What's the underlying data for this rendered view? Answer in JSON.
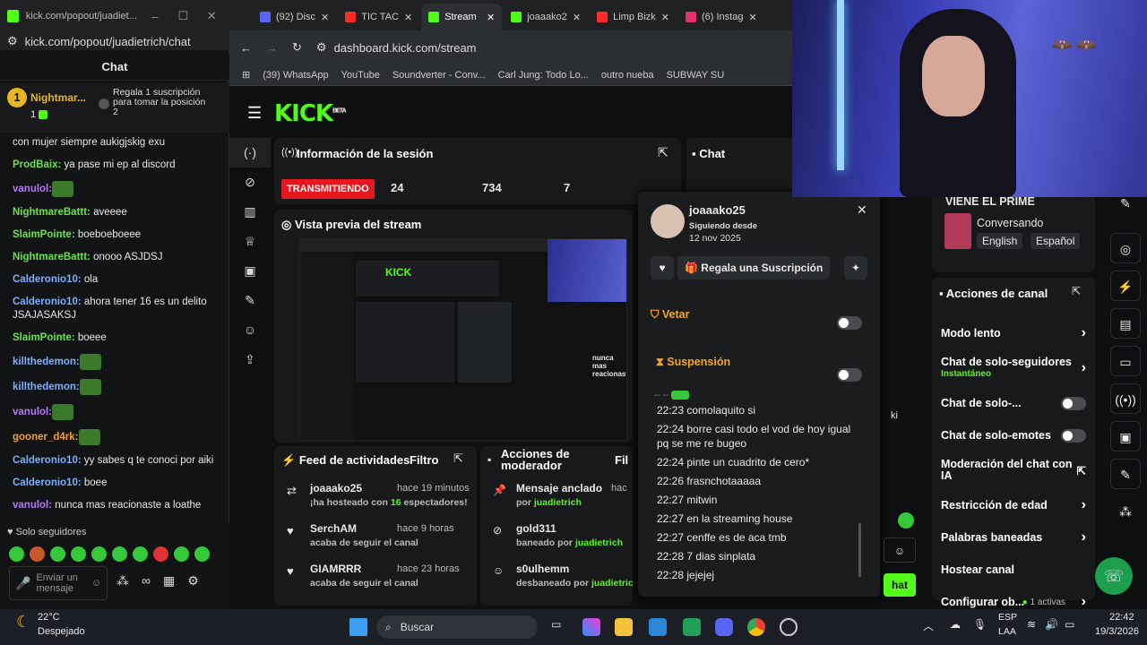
{
  "popout": {
    "title": "kick.com/popout/juadiet...",
    "url": "kick.com/popout/juadietrich/chat",
    "chat_heading": "Chat",
    "pinned_user": "Nightmar...",
    "pinned_rank": "1",
    "pinned_count": "1",
    "pinned_text": "Regala 1 suscripción para tomar la posición 2",
    "messages": [
      {
        "user": "",
        "text": "con mujer siempre aukigjskig exu"
      },
      {
        "user": "ProdBaix:",
        "text": " ya pase mi ep al discord",
        "color": "#6ae24a"
      },
      {
        "user": "vanulol:",
        "text": "",
        "color": "#b877f5"
      },
      {
        "user": "NightmareBattt:",
        "text": " aveeee",
        "color": "#6ae24a"
      },
      {
        "user": "SlaimPointe:",
        "text": " boeboeboeee",
        "color": "#6ae24a"
      },
      {
        "user": "NightmareBattt:",
        "text": " onooo ASJDSJ",
        "color": "#6ae24a"
      },
      {
        "user": "Calderonio10:",
        "text": " ola",
        "color": "#7ab0ff"
      },
      {
        "user": "Calderonio10:",
        "text": " ahora tener 16 es un delito JSAJASAKSJ",
        "color": "#7ab0ff"
      },
      {
        "user": "SlaimPointe:",
        "text": " boeee",
        "color": "#6ae24a"
      },
      {
        "user": "killthedemon:",
        "text": "",
        "color": "#7ab0ff"
      },
      {
        "user": "killthedemon:",
        "text": "",
        "color": "#7ab0ff"
      },
      {
        "user": "vanulol:",
        "text": "",
        "color": "#b877f5"
      },
      {
        "user": "gooner_d4rk:",
        "text": "",
        "color": "#f0a030"
      },
      {
        "user": "Calderonio10:",
        "text": " yy sabes q te conoci por aiki",
        "color": "#7ab0ff"
      },
      {
        "user": "Calderonio10:",
        "text": " boee",
        "color": "#7ab0ff"
      },
      {
        "user": "vanulol:",
        "text": " nunca mas reacionaste a loathe",
        "color": "#b877f5"
      }
    ],
    "followers_only": "Solo seguidores",
    "input_placeholder": "Enviar un mensaje"
  },
  "browser": {
    "tabs": [
      {
        "label": "(92) Disc",
        "color": "#5865f2"
      },
      {
        "label": "TIC TAC",
        "color": "#ff2a2a"
      },
      {
        "label": "Stream",
        "color": "#53fc18",
        "active": true
      },
      {
        "label": "joaaako2",
        "color": "#53fc18"
      },
      {
        "label": "Limp Bizk",
        "color": "#ff2a2a"
      },
      {
        "label": "(6) Instag",
        "color": "#e1306c"
      }
    ],
    "url": "dashboard.kick.com/stream",
    "bookmarks": [
      "(39) WhatsApp",
      "YouTube",
      "Soundverter - Conv...",
      "Carl Jung: Todo Lo...",
      "outro nueba",
      "SUBWAY SU"
    ]
  },
  "kick": {
    "logo": "KICK",
    "beta": "BETA",
    "session_title": "Información de la sesión",
    "live_label": "TRANSMITIENDO",
    "stats": [
      "24",
      "734",
      "7"
    ],
    "preview_title": "Vista previa del stream",
    "chat_title": "Chat",
    "activity_title": "Feed de actividades",
    "filter": "Filtro",
    "activity": [
      {
        "name": "joaaako25",
        "time": "hace 19 minutos",
        "text_a": "¡ha hosteado con ",
        "count": "16",
        "text_b": " espectadores!"
      },
      {
        "name": "SerchAM",
        "time": "hace 9 horas",
        "text_a": "acaba de seguir el canal",
        "count": "",
        "text_b": ""
      },
      {
        "name": "GIAMRRR",
        "time": "hace 23 horas",
        "text_a": "acaba de seguir el canal",
        "count": "",
        "text_b": ""
      }
    ],
    "mod_title": "Acciones de moderador",
    "mod_filter": "Fil",
    "mod_actions": [
      {
        "name": "Mensaje anclado",
        "time": "hac",
        "text": "por ",
        "by": "juadietrich"
      },
      {
        "name": "gold311",
        "time": "",
        "text": "baneado por ",
        "by": "juadietrich"
      },
      {
        "name": "s0ulhemm",
        "time": "",
        "text": "desbaneado por ",
        "by": "juadietric"
      }
    ]
  },
  "popup": {
    "username": "joaaako25",
    "following_label": "Siguiendo desde",
    "following_date": "12 nov 2025",
    "gift_button": "Regala una Suscripción",
    "veto": "Vetar",
    "suspension": "Suspensión",
    "messages": [
      {
        "time": "22:23",
        "text": "comolaquito si"
      },
      {
        "time": "22:24",
        "text": "borre casi todo el vod de hoy igual pq se me re bugeo"
      },
      {
        "time": "22:24",
        "text": "pinte un cuadrito de cero*"
      },
      {
        "time": "22:26",
        "text": "frasnchotaaaaa"
      },
      {
        "time": "22:27",
        "text": "mitwin"
      },
      {
        "time": "22:27",
        "text": "en la streaming house"
      },
      {
        "time": "22:27",
        "text": "cenffe es de aca tmb"
      },
      {
        "time": "22:28",
        "text": "7 dias sinplata"
      },
      {
        "time": "22:28",
        "text": "jejejej"
      }
    ]
  },
  "right": {
    "stream_title": "VIENE EL PRIME",
    "category": "Conversando",
    "tags": [
      "English",
      "Español"
    ],
    "actions_title": "Acciones de canal",
    "actions": [
      {
        "label": "Modo lento",
        "kind": "chevron"
      },
      {
        "label": "Chat de solo-seguidores",
        "sub": "Instantáneo",
        "kind": "chevron"
      },
      {
        "label": "Chat de solo-...",
        "kind": "toggle"
      },
      {
        "label": "Chat de solo-emotes",
        "kind": "toggle"
      },
      {
        "label": "Moderación del chat con IA",
        "kind": "ext"
      },
      {
        "label": "Restricción de edad",
        "kind": "chevron"
      },
      {
        "label": "Palabras baneadas",
        "kind": "chevron"
      },
      {
        "label": "Hostear canal",
        "kind": "none"
      },
      {
        "label": "Configurar ob...",
        "sub_inline": "1 activas",
        "kind": "chevron"
      }
    ],
    "chat_cut": "ki",
    "chat_btn": "hat"
  },
  "taskbar": {
    "temp": "22°C",
    "weather": "Despejado",
    "search": "Buscar",
    "lang1": "ESP",
    "lang2": "LAA",
    "time": "22:42",
    "date": "19/3/2026"
  }
}
